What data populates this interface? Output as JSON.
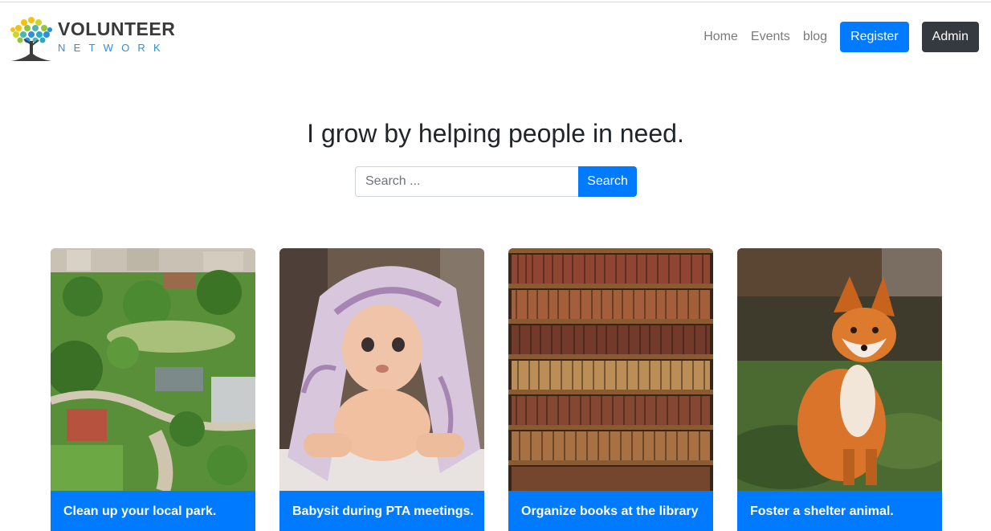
{
  "brand": {
    "name": "VOLUNTEER",
    "sub": "NETWORK"
  },
  "nav": {
    "home": "Home",
    "events": "Events",
    "blog": "blog",
    "register": "Register",
    "admin": "Admin"
  },
  "hero": {
    "title": "I grow by helping people in need."
  },
  "search": {
    "placeholder": "Search ...",
    "button": "Search"
  },
  "cards": [
    {
      "caption": "Clean up your local park.",
      "image": "park-aerial-photo"
    },
    {
      "caption": "Babysit during PTA meetings.",
      "image": "baby-photo"
    },
    {
      "caption": "Organize books at the library",
      "image": "library-bookshelf-photo"
    },
    {
      "caption": "Foster a shelter animal.",
      "image": "fox-photo"
    }
  ],
  "colors": {
    "primary": "#007bff",
    "dark": "#343a40"
  }
}
